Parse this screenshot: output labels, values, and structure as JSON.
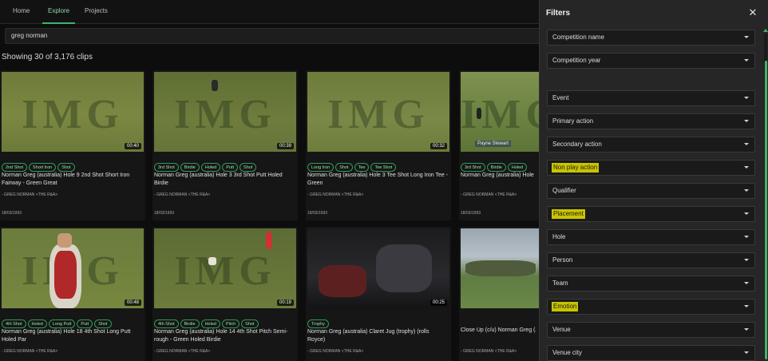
{
  "nav": {
    "tabs": [
      "Home",
      "Explore",
      "Projects"
    ],
    "active": 1
  },
  "search": {
    "value": "greg norman"
  },
  "results_label": "Showing 30 of 3,176 clips",
  "cards": [
    {
      "duration": "00:40",
      "tags": [
        "2nd Shot",
        "Short Iron",
        "Shot"
      ],
      "title": "Norman Greg (australia) Hole 9 2nd Shot Short Iron Fairway - Green Great",
      "person": "- GREG NORMAN <THE R&A>",
      "date": "18/03/1993"
    },
    {
      "duration": "00:39",
      "tags": [
        "3rd Shot",
        "Birdie",
        "Holed",
        "Putt",
        "Shot"
      ],
      "title": "Norman Greg (australia) Hole 3 3rd Shot Putt Holed Birdie",
      "person": "- GREG NORMAN <THE R&A>",
      "date": "18/03/1993"
    },
    {
      "duration": "00:32",
      "tags": [
        "Long Iron",
        "Shot",
        "Tee",
        "Tee Shot"
      ],
      "title": "Norman Greg (australia) Hole 3 Tee Shot Long Iron Tee - Green",
      "person": "- GREG NORMAN <THE R&A>",
      "date": "18/03/1993"
    },
    {
      "duration": "",
      "tags": [
        "3rd Shot",
        "Birdie",
        "Holed"
      ],
      "title": "Norman Greg (australia) Hole 1 Birdie",
      "person": "- GREG NORMAN <THE R&A>",
      "date": "18/03/1993",
      "caption": "Payne Stewart"
    },
    {
      "duration": "00:48",
      "tags": [
        "4th Shot",
        "Holed",
        "Long Putt",
        "Putt",
        "Shot"
      ],
      "title": "Norman Greg (australia) Hole 18 4th Shot Long Putt Holed Par",
      "person": "- GREG NORMAN <THE R&A>",
      "date": ""
    },
    {
      "duration": "00:19",
      "tags": [
        "4th Shot",
        "Birdie",
        "Holed",
        "Pitch",
        "Shot"
      ],
      "title": "Norman Greg (australia) Hole 14 4th Shot Pitch Semi-rough - Green Holed Birdie",
      "person": "- GREG NORMAN <THE R&A>",
      "date": ""
    },
    {
      "duration": "00:25",
      "tags": [
        "Trophy"
      ],
      "title": "Norman Greg (australia) Claret Jug (trophy) (rolls Royce)",
      "person": "- GREG NORMAN <THE R&A>",
      "date": ""
    },
    {
      "duration": "",
      "tags": [],
      "title": "Close Up (c/u) Norman Greg (a",
      "person": "- GREG NORMAN <THE R&A>",
      "date": ""
    }
  ],
  "filters": {
    "title": "Filters",
    "items": [
      {
        "label": "Competition name",
        "highlight": false
      },
      {
        "label": "Competition year",
        "highlight": false
      },
      {
        "label": "Event",
        "highlight": false
      },
      {
        "label": "Primary action",
        "highlight": false
      },
      {
        "label": "Secondary action",
        "highlight": false
      },
      {
        "label": "Non play action",
        "highlight": true
      },
      {
        "label": "Qualifier",
        "highlight": false
      },
      {
        "label": "Placement",
        "highlight": true
      },
      {
        "label": "Hole",
        "highlight": false
      },
      {
        "label": "Person",
        "highlight": false
      },
      {
        "label": "Team",
        "highlight": false
      },
      {
        "label": "Emotion",
        "highlight": true
      },
      {
        "label": "Venue",
        "highlight": false
      },
      {
        "label": "Venue city",
        "highlight": false
      }
    ]
  }
}
